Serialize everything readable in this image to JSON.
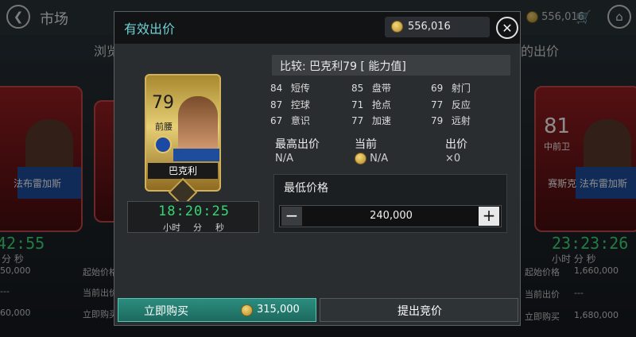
{
  "background": {
    "title": "市场",
    "coins": "556,016",
    "tab_left": "浏览",
    "tab_right": "的出价",
    "left_card": {
      "name": "法布雷加斯"
    },
    "right_card": {
      "rating": "81",
      "position": "中前卫",
      "name": "赛斯克 法布雷加斯"
    },
    "left_timer": "42:55",
    "left_units": "分    秒",
    "right_timer": "23:23:26",
    "right_units": "小时  分   秒",
    "left_rows": [
      {
        "label": "起始价格",
        "value": "50,000"
      },
      {
        "label": "当前出价",
        "value": "---"
      },
      {
        "label": "立即购买",
        "value": "60,000"
      }
    ],
    "right_rows": [
      {
        "label": "起始价格",
        "value": "1,660,000"
      },
      {
        "label": "当前出价",
        "value": "---"
      },
      {
        "label": "立即购买",
        "value": "1,680,000"
      }
    ]
  },
  "dialog": {
    "title": "有效出价",
    "coins": "556,016",
    "card": {
      "rating": "79",
      "position": "前腰",
      "name": "巴克利"
    },
    "timer": {
      "value": "18:20:25",
      "units": [
        "小时",
        "分",
        "秒"
      ]
    },
    "compare_title": "比较: 巴克利79 [ 能力值]",
    "stats": [
      {
        "value": "84",
        "label": "短传"
      },
      {
        "value": "85",
        "label": "盘带"
      },
      {
        "value": "69",
        "label": "射门"
      },
      {
        "value": "87",
        "label": "控球"
      },
      {
        "value": "71",
        "label": "抢点"
      },
      {
        "value": "77",
        "label": "反应"
      },
      {
        "value": "67",
        "label": "意识"
      },
      {
        "value": "77",
        "label": "加速"
      },
      {
        "value": "79",
        "label": "远射"
      }
    ],
    "highest_bid": {
      "label": "最高出价",
      "value": "N/A"
    },
    "current": {
      "label": "当前",
      "value": "N/A"
    },
    "bids": {
      "label": "出价",
      "value": "×0"
    },
    "min_price": {
      "label": "最低价格",
      "value": "240,000"
    },
    "buy_now": {
      "label": "立即购买",
      "price": "315,000"
    },
    "place_bid": {
      "label": "提出竞价"
    }
  }
}
